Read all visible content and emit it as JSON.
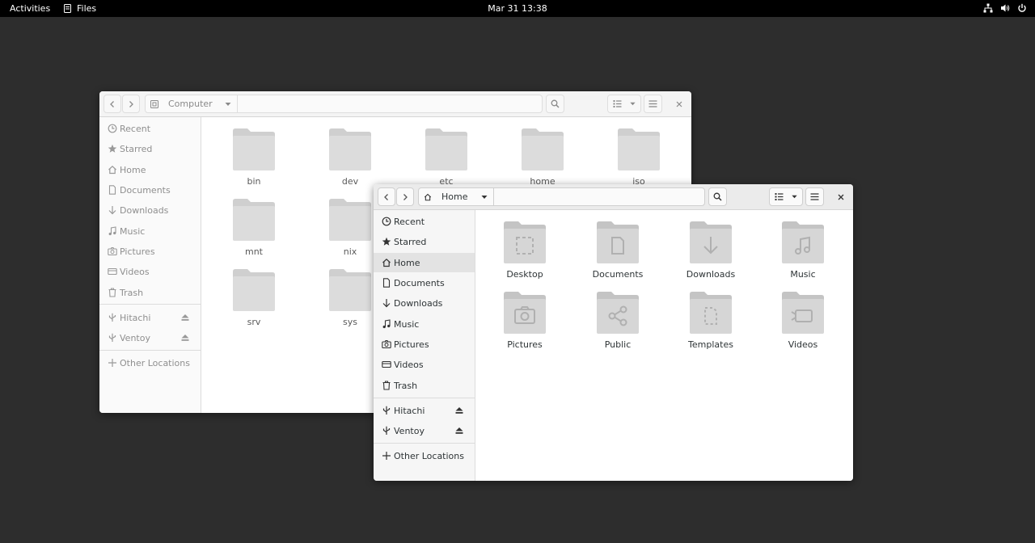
{
  "topbar": {
    "activities": "Activities",
    "app_name": "Files",
    "clock": "Mar 31  13:38"
  },
  "back_window": {
    "location": "Computer",
    "sidebar": {
      "places": [
        "Recent",
        "Starred",
        "Home",
        "Documents",
        "Downloads",
        "Music",
        "Pictures",
        "Videos",
        "Trash"
      ],
      "devices": [
        "Hitachi",
        "Ventoy"
      ],
      "other": "Other Locations"
    },
    "folders": [
      "bin",
      "dev",
      "etc",
      "home",
      "iso",
      "mnt",
      "nix",
      "srv",
      "sys"
    ]
  },
  "front_window": {
    "location": "Home",
    "sidebar": {
      "places": [
        "Recent",
        "Starred",
        "Home",
        "Documents",
        "Downloads",
        "Music",
        "Pictures",
        "Videos",
        "Trash"
      ],
      "devices": [
        "Hitachi",
        "Ventoy"
      ],
      "other": "Other Locations"
    },
    "folders": [
      "Desktop",
      "Documents",
      "Downloads",
      "Music",
      "Pictures",
      "Public",
      "Templates",
      "Videos"
    ]
  }
}
